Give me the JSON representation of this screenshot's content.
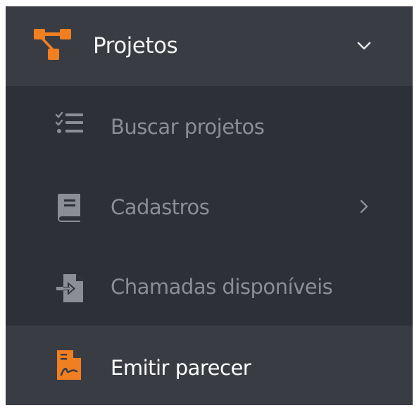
{
  "colors": {
    "menu_background": "#2e3038",
    "header_background": "#3a3c44",
    "accent_orange": "#f07f22",
    "muted_text": "#8b8e96",
    "active_text": "#ffffff"
  },
  "header": {
    "label": "Projetos",
    "icon": "project-tree-icon",
    "expanded": true,
    "chevron_icon": "chevron-down-icon"
  },
  "items": [
    {
      "label": "Buscar projetos",
      "icon": "checklist-icon",
      "active": false,
      "has_submenu": false
    },
    {
      "label": "Cadastros",
      "icon": "book-icon",
      "active": false,
      "has_submenu": true,
      "chevron_icon": "chevron-right-icon"
    },
    {
      "label": "Chamadas disponíveis",
      "icon": "file-import-icon",
      "active": false,
      "has_submenu": false
    },
    {
      "label": "Emitir parecer",
      "icon": "pdf-document-icon",
      "active": true,
      "has_submenu": false
    }
  ]
}
